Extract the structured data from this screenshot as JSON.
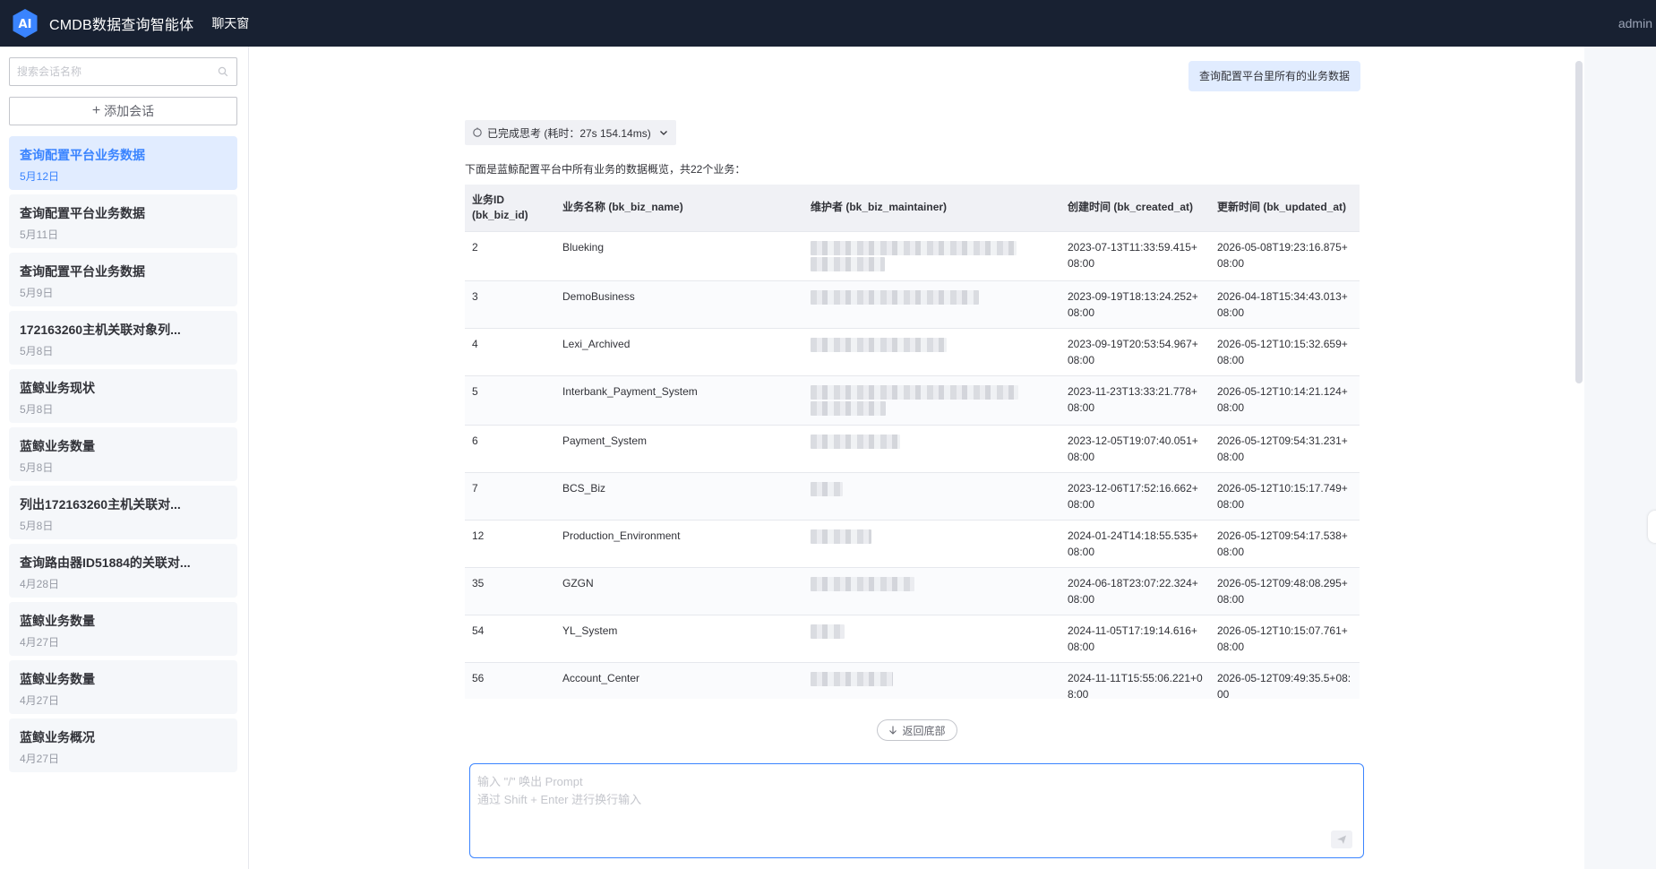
{
  "app": {
    "logo_text": "AI",
    "title": "CMDB数据查询智能体",
    "nav_tab": "聊天窗",
    "user": "admin"
  },
  "sidebar": {
    "search_placeholder": "搜索会话名称",
    "add_label": "添加会话",
    "sessions": [
      {
        "title": "查询配置平台业务数据",
        "date": "5月12日",
        "active": true
      },
      {
        "title": "查询配置平台业务数据",
        "date": "5月11日"
      },
      {
        "title": "查询配置平台业务数据",
        "date": "5月9日"
      },
      {
        "title": "172163260主机关联对象列...",
        "date": "5月8日"
      },
      {
        "title": "蓝鲸业务现状",
        "date": "5月8日"
      },
      {
        "title": "蓝鲸业务数量",
        "date": "5月8日"
      },
      {
        "title": "列出172163260主机关联对...",
        "date": "5月8日"
      },
      {
        "title": "查询路由器ID51884的关联对...",
        "date": "4月28日"
      },
      {
        "title": "蓝鲸业务数量",
        "date": "4月27日"
      },
      {
        "title": "蓝鲸业务数量",
        "date": "4月27日"
      },
      {
        "title": "蓝鲸业务概况",
        "date": "4月27日"
      }
    ]
  },
  "chat": {
    "user_message": "查询配置平台里所有的业务数据",
    "think_label": "已完成思考 (耗时：27s 154.14ms)",
    "summary": "下面是蓝鲸配置平台中所有业务的数据概览，共22个业务：",
    "table": {
      "headers": [
        "业务ID (bk_biz_id)",
        "业务名称 (bk_biz_name)",
        "维护者 (bk_biz_maintainer)",
        "创建时间 (bk_created_at)",
        "更新时间 (bk_updated_at)"
      ],
      "rows": [
        {
          "id": "2",
          "name": "Blueking",
          "created": "2023-07-13T11:33:59.415+08:00",
          "updated": "2026-05-08T19:23:16.875+08:00",
          "maint_w": 230,
          "maint_lines": 2
        },
        {
          "id": "3",
          "name": "DemoBusiness",
          "created": "2023-09-19T18:13:24.252+08:00",
          "updated": "2026-04-18T15:34:43.013+08:00",
          "maint_w": 188,
          "maint_lines": 1
        },
        {
          "id": "4",
          "name": "Lexi_Archived",
          "created": "2023-09-19T20:53:54.967+08:00",
          "updated": "2026-05-12T10:15:32.659+08:00",
          "maint_w": 152,
          "maint_lines": 1
        },
        {
          "id": "5",
          "name": "Interbank_Payment_System",
          "created": "2023-11-23T13:33:21.778+08:00",
          "updated": "2026-05-12T10:14:21.124+08:00",
          "maint_w": 232,
          "maint_lines": 2
        },
        {
          "id": "6",
          "name": "Payment_System",
          "created": "2023-12-05T19:07:40.051+08:00",
          "updated": "2026-05-12T09:54:31.231+08:00",
          "maint_w": 100,
          "maint_lines": 1
        },
        {
          "id": "7",
          "name": "BCS_Biz",
          "created": "2023-12-06T17:52:16.662+08:00",
          "updated": "2026-05-12T10:15:17.749+08:00",
          "maint_w": 36,
          "maint_lines": 1
        },
        {
          "id": "12",
          "name": "Production_Environment",
          "created": "2024-01-24T14:18:55.535+08:00",
          "updated": "2026-05-12T09:54:17.538+08:00",
          "maint_w": 68,
          "maint_lines": 1
        },
        {
          "id": "35",
          "name": "GZGN",
          "created": "2024-06-18T23:07:22.324+08:00",
          "updated": "2026-05-12T09:48:08.295+08:00",
          "maint_w": 116,
          "maint_lines": 1
        },
        {
          "id": "54",
          "name": "YL_System",
          "created": "2024-11-05T17:19:14.616+08:00",
          "updated": "2026-05-12T10:15:07.761+08:00",
          "maint_w": 38,
          "maint_lines": 1
        },
        {
          "id": "56",
          "name": "Account_Center",
          "created": "2024-11-11T15:55:06.221+08:00",
          "updated": "2026-05-12T09:49:35.5+08:00",
          "maint_w": 92,
          "maint_lines": 1
        }
      ]
    },
    "back_bottom_label": "返回底部",
    "input_placeholder": "输入 \"/\" 唤出 Prompt\n通过 Shift + Enter 进行换行输入"
  },
  "colors": {
    "topbar": "#182132",
    "accent": "#3a84ff",
    "active_session_bg": "#e1ecff"
  }
}
